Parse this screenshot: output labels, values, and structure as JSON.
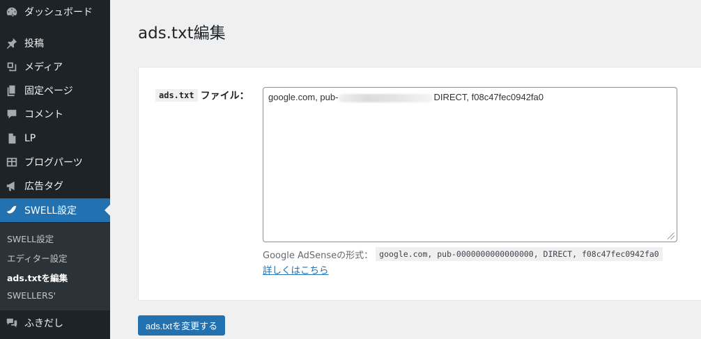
{
  "sidebar": {
    "menu": [
      {
        "label": "ダッシュボード",
        "icon": "dashboard-icon"
      },
      {
        "label": "投稿",
        "icon": "pin-icon"
      },
      {
        "label": "メディア",
        "icon": "media-icon"
      },
      {
        "label": "固定ページ",
        "icon": "page-icon"
      },
      {
        "label": "コメント",
        "icon": "comment-icon"
      },
      {
        "label": "LP",
        "icon": "document-icon"
      },
      {
        "label": "ブログパーツ",
        "icon": "grid-icon"
      },
      {
        "label": "広告タグ",
        "icon": "megaphone-icon"
      },
      {
        "label": "SWELL設定",
        "icon": "swell-icon"
      },
      {
        "label": "ふきだし",
        "icon": "speech-bubbles-icon"
      }
    ],
    "submenu": [
      {
        "label": "SWELL設定"
      },
      {
        "label": "エディター設定"
      },
      {
        "label": "ads.txtを編集"
      },
      {
        "label": "SWELLERS'"
      }
    ]
  },
  "main": {
    "title": "ads.txt編集",
    "field_label_code": "ads.txt",
    "field_label_text": "ファイル：",
    "textarea_prefix": "google.com, pub-",
    "textarea_suffix": "DIRECT, f08c47fec0942fa0",
    "desc_text": "Google AdSenseの形式：",
    "desc_code": "google.com, pub-0000000000000000, DIRECT, f08c47fec0942fa0",
    "link": "詳しくはこちら",
    "submit": "ads.txtを変更する"
  },
  "colors": {
    "sidebar_bg": "#1d2327",
    "accent": "#2271b1",
    "page_bg": "#f0f0f1"
  }
}
